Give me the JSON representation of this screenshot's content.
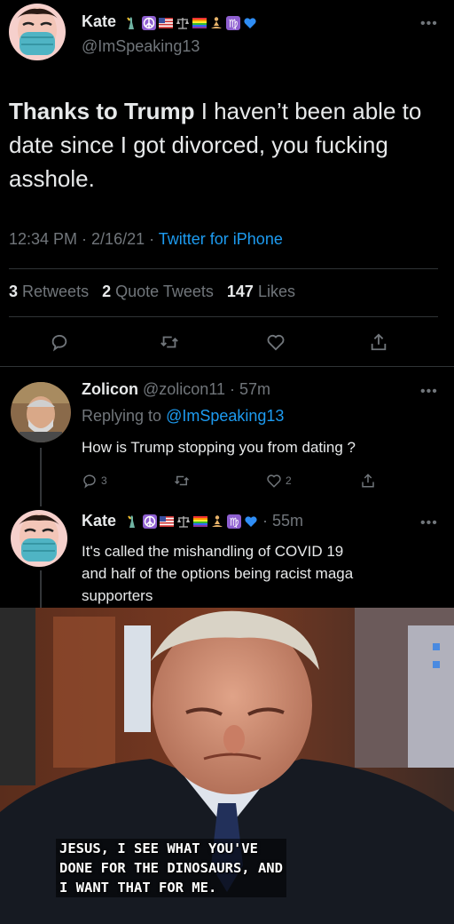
{
  "tweet": {
    "author_name": "Kate",
    "author_handle": "@ImSpeaking13",
    "text_bold": "Thanks to Trump",
    "text_rest": " I haven’t been able to date since I got divorced, you fucking asshole.",
    "time": "12:34 PM · 2/16/21 · ",
    "source": "Twitter for iPhone",
    "retweets_count": "3",
    "retweets_label": "Retweets",
    "quotes_count": "2",
    "quotes_label": "Quote Tweets",
    "likes_count": "147",
    "likes_label": "Likes"
  },
  "reply1": {
    "author_name": "Zolicon",
    "author_handle": "@zolicon11",
    "time": " · 57m",
    "replying_prefix": "Replying to ",
    "replying_handle": "@ImSpeaking13",
    "text": "How is Trump stopping you from dating ?",
    "reply_count": "3",
    "like_count": "2"
  },
  "reply2": {
    "author_name": "Kate",
    "time": " · 55m",
    "text_line1": "It's called the mishandling of COVID 19",
    "text_line2": "and half of the options being racist maga",
    "text_line3": "supporters"
  },
  "meme": {
    "caption_line1": "JESUS, I SEE WHAT YOU'VE",
    "caption_line2": "DONE FOR THE DINOSAURS, AND",
    "caption_line3": "I WANT THAT FOR ME."
  },
  "icons": {
    "emoji_set": [
      "statue-of-liberty-icon",
      "peace-icon",
      "us-flag-icon",
      "scales-icon",
      "rainbow-flag-icon",
      "meditation-icon",
      "virgo-icon",
      "blue-heart-icon"
    ],
    "actions": [
      "reply-icon",
      "retweet-icon",
      "like-icon",
      "share-icon"
    ]
  },
  "colors": {
    "background": "#000000",
    "text": "#e7e9ea",
    "muted": "#71767b",
    "accent": "#1d9bf0",
    "divider": "#2f3336"
  }
}
